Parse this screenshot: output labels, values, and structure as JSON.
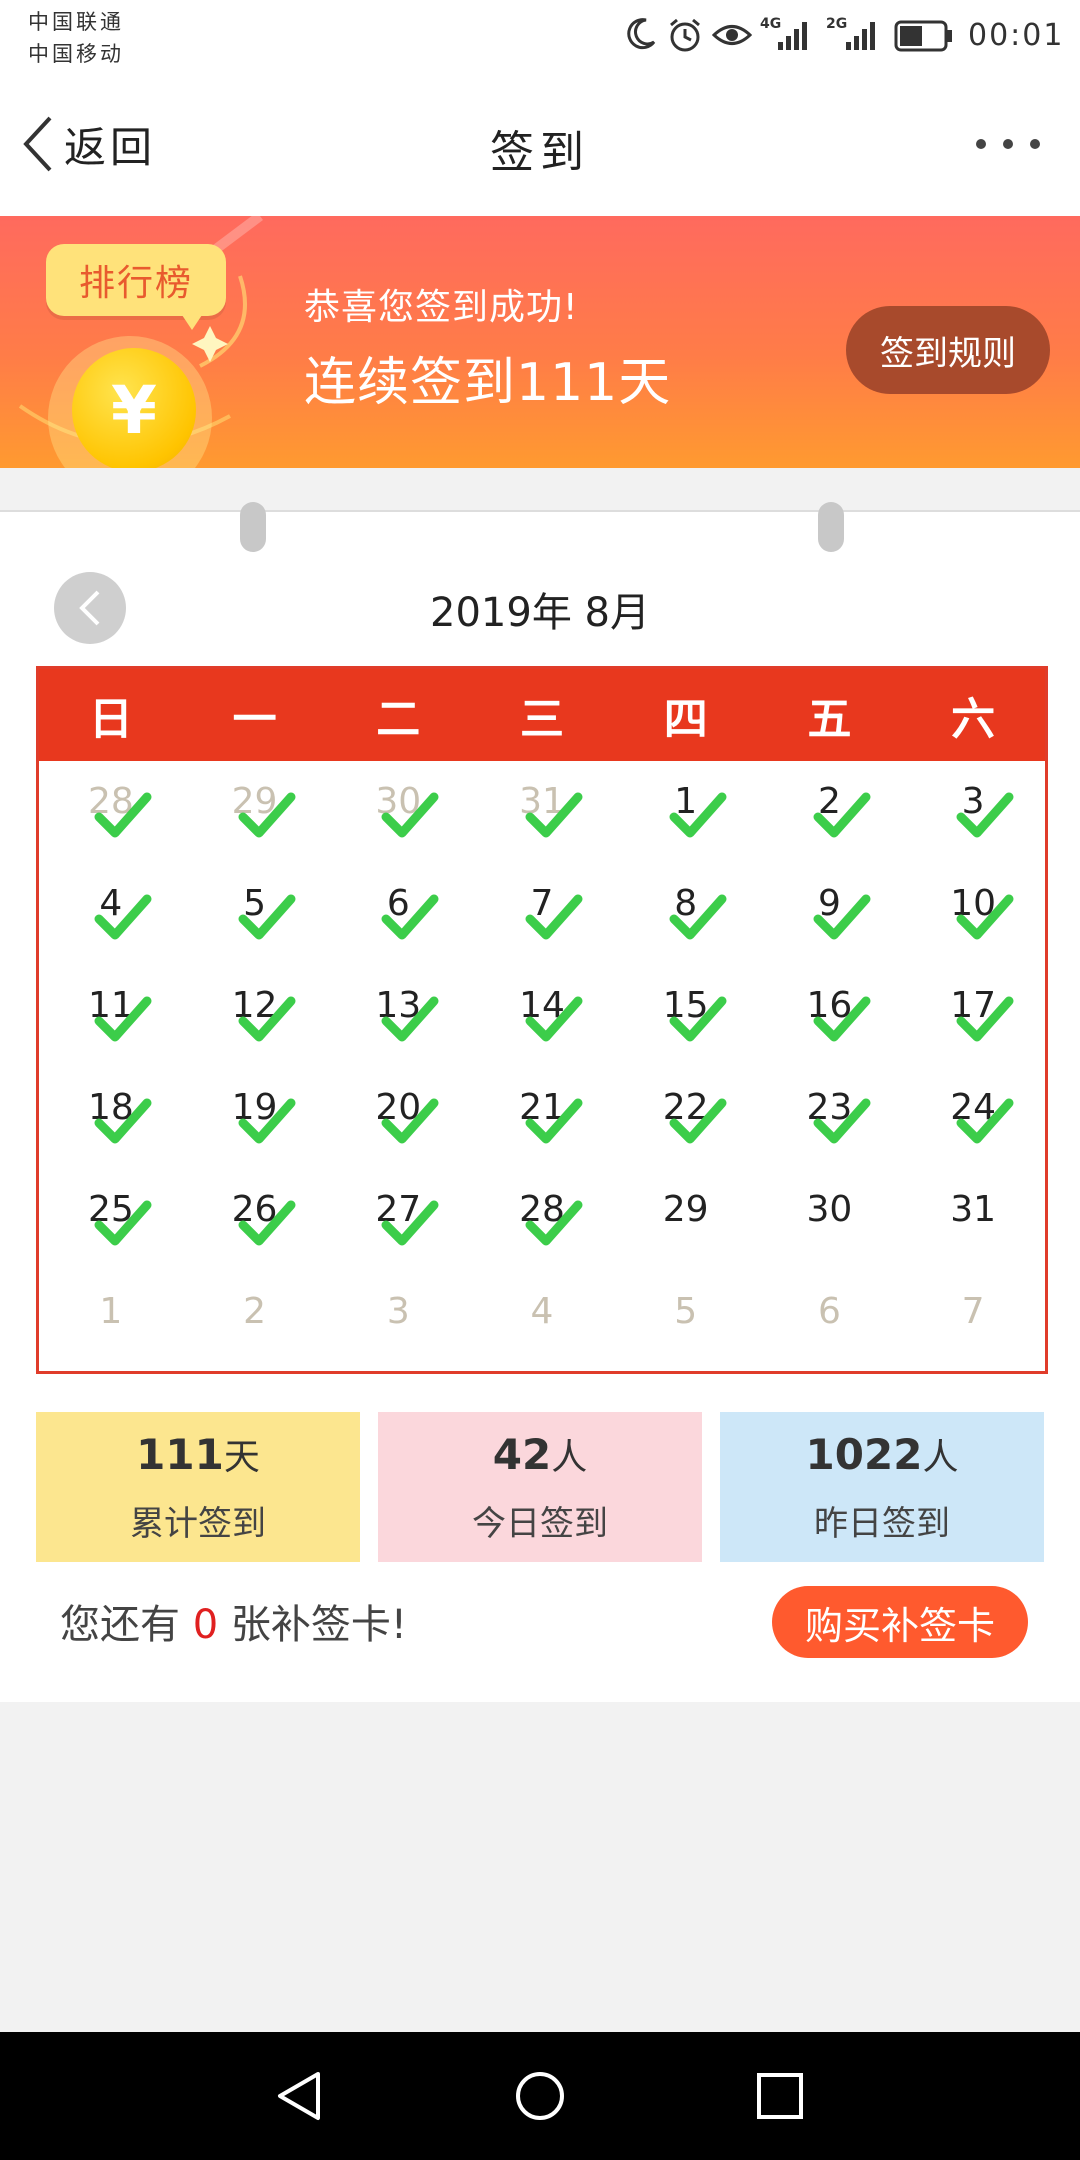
{
  "status_bar": {
    "carrier_1": "中国联通",
    "carrier_2": "中国移动",
    "network_1": "4G",
    "network_2": "2G",
    "time": "00:01",
    "icons": [
      "moon-icon",
      "alarm-icon",
      "eye-icon",
      "signal-4g-icon",
      "signal-2g-icon",
      "battery-icon"
    ]
  },
  "nav": {
    "back_label": "返回",
    "title": "签到",
    "more_icon": "more-dots-icon"
  },
  "banner": {
    "rank_label": "排行榜",
    "coin_symbol": "¥",
    "message": "恭喜您签到成功!",
    "streak": "连续签到111天",
    "rules_button": "签到规则"
  },
  "calendar": {
    "month_title": "2019年 8月",
    "weekdays": [
      "日",
      "一",
      "二",
      "三",
      "四",
      "五",
      "六"
    ],
    "days": [
      {
        "d": "28",
        "muted": true,
        "checked": true
      },
      {
        "d": "29",
        "muted": true,
        "checked": true
      },
      {
        "d": "30",
        "muted": true,
        "checked": true
      },
      {
        "d": "31",
        "muted": true,
        "checked": true
      },
      {
        "d": "1",
        "muted": false,
        "checked": true
      },
      {
        "d": "2",
        "muted": false,
        "checked": true
      },
      {
        "d": "3",
        "muted": false,
        "checked": true
      },
      {
        "d": "4",
        "muted": false,
        "checked": true
      },
      {
        "d": "5",
        "muted": false,
        "checked": true
      },
      {
        "d": "6",
        "muted": false,
        "checked": true
      },
      {
        "d": "7",
        "muted": false,
        "checked": true
      },
      {
        "d": "8",
        "muted": false,
        "checked": true
      },
      {
        "d": "9",
        "muted": false,
        "checked": true
      },
      {
        "d": "10",
        "muted": false,
        "checked": true
      },
      {
        "d": "11",
        "muted": false,
        "checked": true
      },
      {
        "d": "12",
        "muted": false,
        "checked": true
      },
      {
        "d": "13",
        "muted": false,
        "checked": true
      },
      {
        "d": "14",
        "muted": false,
        "checked": true
      },
      {
        "d": "15",
        "muted": false,
        "checked": true
      },
      {
        "d": "16",
        "muted": false,
        "checked": true
      },
      {
        "d": "17",
        "muted": false,
        "checked": true
      },
      {
        "d": "18",
        "muted": false,
        "checked": true
      },
      {
        "d": "19",
        "muted": false,
        "checked": true
      },
      {
        "d": "20",
        "muted": false,
        "checked": true
      },
      {
        "d": "21",
        "muted": false,
        "checked": true
      },
      {
        "d": "22",
        "muted": false,
        "checked": true
      },
      {
        "d": "23",
        "muted": false,
        "checked": true
      },
      {
        "d": "24",
        "muted": false,
        "checked": true
      },
      {
        "d": "25",
        "muted": false,
        "checked": true
      },
      {
        "d": "26",
        "muted": false,
        "checked": true
      },
      {
        "d": "27",
        "muted": false,
        "checked": true
      },
      {
        "d": "28",
        "muted": false,
        "checked": true
      },
      {
        "d": "29",
        "muted": false,
        "checked": false
      },
      {
        "d": "30",
        "muted": false,
        "checked": false
      },
      {
        "d": "31",
        "muted": false,
        "checked": false
      },
      {
        "d": "1",
        "muted": true,
        "checked": false
      },
      {
        "d": "2",
        "muted": true,
        "checked": false
      },
      {
        "d": "3",
        "muted": true,
        "checked": false
      },
      {
        "d": "4",
        "muted": true,
        "checked": false
      },
      {
        "d": "5",
        "muted": true,
        "checked": false
      },
      {
        "d": "6",
        "muted": true,
        "checked": false
      },
      {
        "d": "7",
        "muted": true,
        "checked": false
      }
    ]
  },
  "stats": [
    {
      "value": "111",
      "unit": "天",
      "label": "累计签到",
      "bg": "#fce68f"
    },
    {
      "value": "42",
      "unit": "人",
      "label": "今日签到",
      "bg": "#fbd7dc"
    },
    {
      "value": "1022",
      "unit": "人",
      "label": "昨日签到",
      "bg": "#cde7f8"
    }
  ],
  "makeup": {
    "prefix": "您还有",
    "count": "0",
    "suffix": "张补签卡!",
    "buy_button": "购买补签卡"
  },
  "colors": {
    "header_red": "#e8381e",
    "check_green": "#3ccd4a",
    "accent_orange": "#ff5a2e"
  },
  "android_nav": [
    "back-triangle-icon",
    "home-circle-icon",
    "recents-square-icon"
  ]
}
